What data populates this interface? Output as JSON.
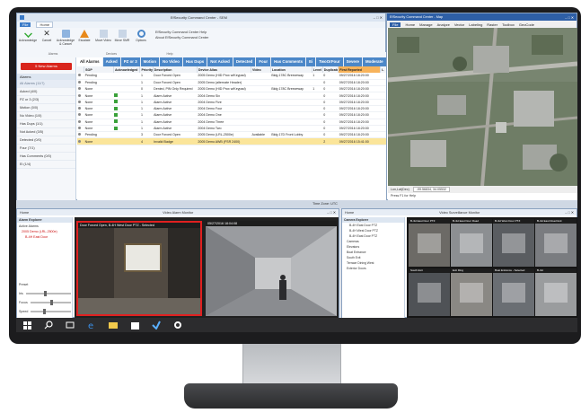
{
  "win_alarm": {
    "title": "EfSecurity Command Center - SEM",
    "menu": [
      "File",
      "Home"
    ],
    "ribbon_buttons": [
      "Acknowledge",
      "Cancel",
      "Acknowledge & Cancel",
      "Escalate",
      "Move Video",
      "Move SMR",
      "Options"
    ],
    "ribbon_groups": [
      "Alarms",
      "Devices",
      "Help"
    ],
    "help_links": [
      "EfSecurity Command Center Help",
      "About EfSecurity Command Center"
    ],
    "new_alarm_button": "5 New Alarms",
    "side_header": "Alarms",
    "side_items": [
      "All Alarms (11/7)",
      "Acked (4/0)",
      "PZ or 3 (2/3)",
      "Motion (0/0)",
      "No Video (1/0)",
      "Has Dups (1/1)",
      "Not Acked (3/5)",
      "Detected (0/0)",
      "Four (7/1)",
      "Has Comments (0/0)",
      "Ei (1/4)"
    ],
    "tabs": [
      "All Alarms",
      "Acked",
      "PZ or 3",
      "Motion",
      "No Video",
      "Has Dups",
      "Not Acked",
      "Detected",
      "Four",
      "Has Comments",
      "Ei",
      "TwoOrFour",
      "Severe",
      "Moderate"
    ],
    "columns": [
      "",
      "SOP",
      "Acknowledged",
      "Priority",
      "Description",
      "Device Alias",
      "Video",
      "Location",
      "Level",
      "Duplicate",
      "First Reported",
      "L"
    ],
    "rows": [
      [
        "",
        "Pending",
        "",
        "1",
        "Door Forced Open",
        "2005 Demo (HID Prox w/Keypad)",
        "",
        "Bldg 178C Breezeway",
        "1",
        "0",
        "09/27/2016 18:20:00",
        ""
      ],
      [
        "",
        "Pending",
        "",
        "1",
        "Door Forced Open",
        "2005 Demo (alternate Header)",
        "",
        "",
        "",
        "0",
        "09/27/2016 18:20:00",
        ""
      ],
      [
        "",
        "None",
        "",
        "0",
        "Denied, PIN Only Required",
        "2005 Demo (HID Prox w/Keypad)",
        "",
        "Bldg 178C Breezeway",
        "1",
        "0",
        "09/27/2016 18:20:00",
        ""
      ],
      [
        "",
        "None",
        "ack",
        "1",
        "Alarm Active",
        "2004 Demo Six",
        "",
        "",
        "",
        "0",
        "09/27/2016 18:20:00",
        ""
      ],
      [
        "",
        "None",
        "ack",
        "1",
        "Alarm Active",
        "2004 Demo Five",
        "",
        "",
        "",
        "0",
        "09/27/2016 18:20:00",
        ""
      ],
      [
        "",
        "None",
        "ack",
        "1",
        "Alarm Active",
        "2004 Demo Four",
        "",
        "",
        "",
        "0",
        "09/27/2016 18:20:00",
        ""
      ],
      [
        "",
        "None",
        "ack",
        "1",
        "Alarm Active",
        "2004 Demo One",
        "",
        "",
        "",
        "0",
        "09/27/2016 18:20:00",
        ""
      ],
      [
        "",
        "None",
        "ack",
        "1",
        "Alarm Active",
        "2004 Demo Three",
        "",
        "",
        "",
        "0",
        "09/27/2016 18:20:00",
        ""
      ],
      [
        "",
        "None",
        "ack",
        "1",
        "Alarm Active",
        "2004 Demo Two",
        "",
        "",
        "",
        "0",
        "09/27/2016 18:20:00",
        ""
      ],
      [
        "",
        "Pending",
        "",
        "3",
        "Door Forced Open",
        "2005 Demo (LRL-2500e)",
        "Available",
        "Bldg 17D Front Lobby",
        "",
        "0",
        "09/27/2016 18:20:00",
        ""
      ],
      [
        "",
        "None",
        "",
        "4",
        "Invalid Badge",
        "2005 Demo AWB (FSR 2400)",
        "",
        "",
        "",
        "2",
        "09/27/2016 15:41:00",
        ""
      ]
    ],
    "selected_row": 10
  },
  "win_map": {
    "title": "EfSecurity Command Center - Map",
    "menu": [
      "File",
      "Home",
      "Manage",
      "Analyze",
      "Vector",
      "Labeling",
      "Raster",
      "Toolbox",
      "GeoCode"
    ],
    "coords": "Lon,Lat(Dec)",
    "scale_value": "-99.56834, 34.05532",
    "status": "Press F1 for Help"
  },
  "strip": {
    "timezone": "Time Zone: UTC"
  },
  "win_video": {
    "title": "Video Alarm Monitor",
    "tab": "Home",
    "tree_header": "Alarm Explorer",
    "tree_items": [
      "Active Alarms",
      "2005 Demo (LRL-2500e)",
      "B-4H East Door"
    ],
    "cam1_label": "Door Forced Open, B-4H West Door PTZ - Selected",
    "cam2_label": "05/27/2016 18:04:08",
    "ptz": [
      "Preset",
      "Iris",
      "Focus",
      "Speed"
    ]
  },
  "win_surveil": {
    "title": "Video Surveillance Monitor",
    "tab": "Home",
    "tree_header": "Camera Explorer",
    "tree_items": [
      "B-4H East Door PTZ",
      "B-4H West Door PTZ",
      "B-4H East Door PTZ",
      "Cameras",
      "Elevators",
      "Boat Entrance",
      "South Exit",
      "Terrace Dining West",
      "Exterior Doors"
    ],
    "tiles": [
      "B-4H East Door PTZ",
      "B-4H East Door Road",
      "B-4H West Door PTZ",
      "B-4H East Road Exit",
      "South Exit",
      "Exit Ring",
      "Boat Entrance - Selected",
      "B-4H"
    ]
  },
  "taskbar": [
    "windows-logo",
    "search",
    "task-view",
    "edge",
    "explorer",
    "store",
    "mail",
    "settings"
  ],
  "colors": {
    "tab_blue": "#4b87c8",
    "alarm_red": "#d9251c",
    "selected_row": "#fbe59a",
    "ack_green": "#3aa13a"
  }
}
